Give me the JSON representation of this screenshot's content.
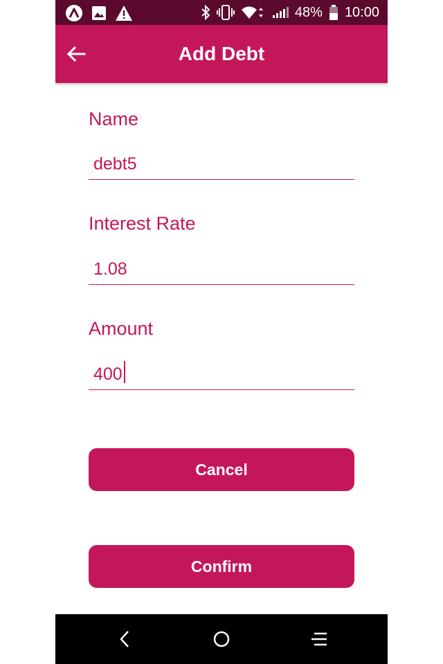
{
  "status_bar": {
    "battery_percent": "48%",
    "time": "10:00",
    "icons": [
      "app-logo-icon",
      "image-icon",
      "warning-icon",
      "bluetooth-icon",
      "vibrate-icon",
      "wifi-icon",
      "signal-icon",
      "battery-icon"
    ]
  },
  "app_bar": {
    "title": "Add Debt",
    "back_icon": "arrow-left-icon"
  },
  "form": {
    "name": {
      "label": "Name",
      "value": "debt5"
    },
    "interest_rate": {
      "label": "Interest Rate",
      "value": "1.08"
    },
    "amount": {
      "label": "Amount",
      "value": "400"
    }
  },
  "buttons": {
    "cancel": "Cancel",
    "confirm": "Confirm"
  },
  "nav_bar": {
    "icons": [
      "nav-back-icon",
      "nav-home-icon",
      "nav-menu-icon"
    ]
  },
  "colors": {
    "primary": "#c4175a",
    "status_bar": "#5b0a2e",
    "nav_bar": "#000000"
  }
}
